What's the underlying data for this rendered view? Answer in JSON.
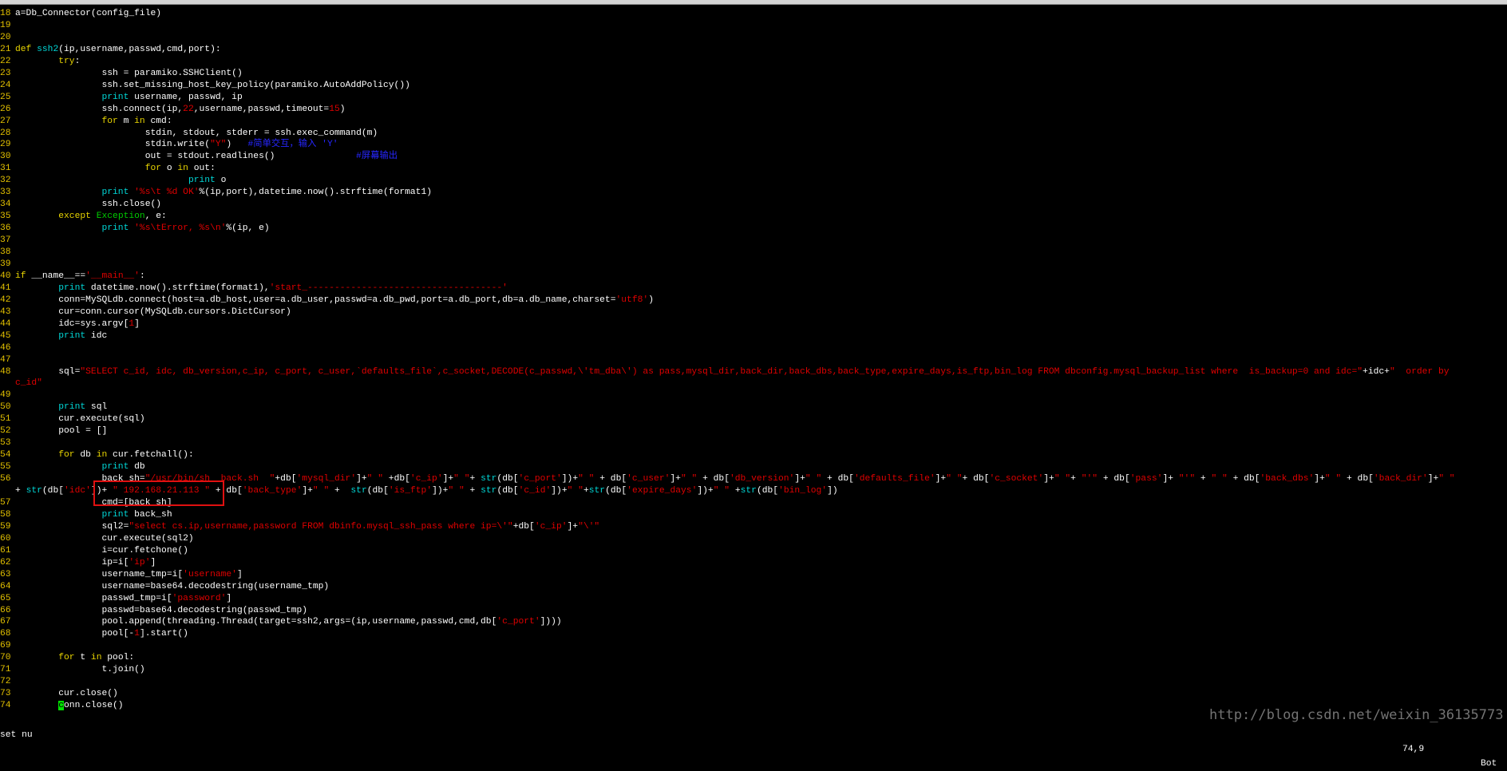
{
  "lines": [
    {
      "n": "18",
      "s": [
        [
          "t",
          "a=Db_Connector(config_file)"
        ]
      ]
    },
    {
      "n": "19",
      "s": []
    },
    {
      "n": "20",
      "s": []
    },
    {
      "n": "21",
      "s": [
        [
          "kw",
          "def"
        ],
        [
          "t",
          " "
        ],
        [
          "fn",
          "ssh2"
        ],
        [
          "t",
          "(ip,username,passwd,cmd,port):"
        ]
      ]
    },
    {
      "n": "22",
      "s": [
        [
          "t",
          "        "
        ],
        [
          "kw",
          "try"
        ],
        [
          "t",
          ":"
        ]
      ]
    },
    {
      "n": "23",
      "s": [
        [
          "t",
          "                ssh = paramiko.SSHClient()"
        ]
      ]
    },
    {
      "n": "24",
      "s": [
        [
          "t",
          "                ssh.set_missing_host_key_policy(paramiko.AutoAddPolicy())"
        ]
      ]
    },
    {
      "n": "25",
      "s": [
        [
          "t",
          "                "
        ],
        [
          "pr",
          "print"
        ],
        [
          "t",
          " username, passwd, ip"
        ]
      ]
    },
    {
      "n": "26",
      "s": [
        [
          "t",
          "                ssh.connect(ip,"
        ],
        [
          "nu",
          "22"
        ],
        [
          "t",
          ",username,passwd,timeout="
        ],
        [
          "nu",
          "15"
        ],
        [
          "t",
          ")"
        ]
      ]
    },
    {
      "n": "27",
      "s": [
        [
          "t",
          "                "
        ],
        [
          "kw",
          "for"
        ],
        [
          "t",
          " m "
        ],
        [
          "kw",
          "in"
        ],
        [
          "t",
          " cmd:"
        ]
      ]
    },
    {
      "n": "28",
      "s": [
        [
          "t",
          "                        stdin, stdout, stderr = ssh.exec_command(m)"
        ]
      ]
    },
    {
      "n": "29",
      "s": [
        [
          "t",
          "                        stdin.write("
        ],
        [
          "st",
          "\"Y\""
        ],
        [
          "t",
          ")   "
        ],
        [
          "cm",
          "#简单交互，输入 'Y'"
        ]
      ]
    },
    {
      "n": "30",
      "s": [
        [
          "t",
          "                        out = stdout.readlines()               "
        ],
        [
          "cm",
          "#屏幕输出"
        ]
      ]
    },
    {
      "n": "31",
      "s": [
        [
          "t",
          "                        "
        ],
        [
          "kw",
          "for"
        ],
        [
          "t",
          " o "
        ],
        [
          "kw",
          "in"
        ],
        [
          "t",
          " out:"
        ]
      ]
    },
    {
      "n": "32",
      "s": [
        [
          "t",
          "                                "
        ],
        [
          "pr",
          "print"
        ],
        [
          "t",
          " o"
        ]
      ]
    },
    {
      "n": "33",
      "s": [
        [
          "t",
          "                "
        ],
        [
          "pr",
          "print"
        ],
        [
          "t",
          " "
        ],
        [
          "st",
          "'%s\\t %d OK'"
        ],
        [
          "t",
          "%(ip,port),datetime.now().strftime(format1)"
        ]
      ]
    },
    {
      "n": "34",
      "s": [
        [
          "t",
          "                ssh.close()"
        ]
      ]
    },
    {
      "n": "35",
      "s": [
        [
          "t",
          "        "
        ],
        [
          "kw",
          "except"
        ],
        [
          "t",
          " "
        ],
        [
          "ex",
          "Exception"
        ],
        [
          "t",
          ", e:"
        ]
      ]
    },
    {
      "n": "36",
      "s": [
        [
          "t",
          "                "
        ],
        [
          "pr",
          "print"
        ],
        [
          "t",
          " "
        ],
        [
          "st",
          "'%s\\tError, %s\\n'"
        ],
        [
          "t",
          "%(ip, e)"
        ]
      ]
    },
    {
      "n": "37",
      "s": []
    },
    {
      "n": "38",
      "s": []
    },
    {
      "n": "39",
      "s": []
    },
    {
      "n": "40",
      "s": [
        [
          "kw",
          "if"
        ],
        [
          "t",
          " __name__=="
        ],
        [
          "st",
          "'__main__'"
        ],
        [
          "t",
          ":"
        ]
      ]
    },
    {
      "n": "41",
      "s": [
        [
          "t",
          "        "
        ],
        [
          "pr",
          "print"
        ],
        [
          "t",
          " datetime.now().strftime(format1),"
        ],
        [
          "st",
          "'start_------------------------------------'"
        ]
      ]
    },
    {
      "n": "42",
      "s": [
        [
          "t",
          "        conn=MySQLdb.connect(host=a.db_host,user=a.db_user,passwd=a.db_pwd,port=a.db_port,db=a.db_name,charset="
        ],
        [
          "st",
          "'utf8'"
        ],
        [
          "t",
          ")"
        ]
      ]
    },
    {
      "n": "43",
      "s": [
        [
          "t",
          "        cur=conn.cursor(MySQLdb.cursors.DictCursor)"
        ]
      ]
    },
    {
      "n": "44",
      "s": [
        [
          "t",
          "        idc=sys.argv["
        ],
        [
          "nu",
          "1"
        ],
        [
          "t",
          "]"
        ]
      ]
    },
    {
      "n": "45",
      "s": [
        [
          "t",
          "        "
        ],
        [
          "pr",
          "print"
        ],
        [
          "t",
          " idc"
        ]
      ]
    },
    {
      "n": "46",
      "s": []
    },
    {
      "n": "47",
      "s": []
    },
    {
      "n": "48",
      "s": [
        [
          "t",
          "        sql="
        ],
        [
          "st",
          "\"SELECT c_id, idc, db_version,c_ip, c_port, c_user,`defaults_file`,c_socket,DECODE(c_passwd,\\'tm_dba\\') as pass,mysql_dir,back_dir,back_dbs,back_type,expire_days,is_ftp,bin_log FROM dbconfig.mysql_backup_list where  is_backup=0 and idc=\""
        ],
        [
          "t",
          "+idc+"
        ],
        [
          "st",
          "\"  order by"
        ]
      ]
    },
    {
      "n": "",
      "s": [
        [
          "st",
          "c_id\""
        ]
      ]
    },
    {
      "n": "49",
      "s": []
    },
    {
      "n": "50",
      "s": [
        [
          "t",
          "        "
        ],
        [
          "pr",
          "print"
        ],
        [
          "t",
          " sql"
        ]
      ]
    },
    {
      "n": "51",
      "s": [
        [
          "t",
          "        cur.execute(sql)"
        ]
      ]
    },
    {
      "n": "52",
      "s": [
        [
          "t",
          "        pool = []"
        ]
      ]
    },
    {
      "n": "53",
      "s": []
    },
    {
      "n": "54",
      "s": [
        [
          "t",
          "        "
        ],
        [
          "kw",
          "for"
        ],
        [
          "t",
          " db "
        ],
        [
          "kw",
          "in"
        ],
        [
          "t",
          " cur.fetchall():"
        ]
      ]
    },
    {
      "n": "55",
      "s": [
        [
          "t",
          "                "
        ],
        [
          "pr",
          "print"
        ],
        [
          "t",
          " db"
        ]
      ]
    },
    {
      "n": "56",
      "s": [
        [
          "t",
          "                back_sh="
        ],
        [
          "st",
          "\"/usr/bin/sh  back.sh  \""
        ],
        [
          "t",
          "+db["
        ],
        [
          "st",
          "'mysql_dir'"
        ],
        [
          "t",
          "]+"
        ],
        [
          "st",
          "\" \""
        ],
        [
          "t",
          " +db["
        ],
        [
          "st",
          "'c_ip'"
        ],
        [
          "t",
          "]+"
        ],
        [
          "st",
          "\" \""
        ],
        [
          "t",
          "+ "
        ],
        [
          "fn",
          "str"
        ],
        [
          "t",
          "(db["
        ],
        [
          "st",
          "'c_port'"
        ],
        [
          "t",
          "])+"
        ],
        [
          "st",
          "\" \""
        ],
        [
          "t",
          " + db["
        ],
        [
          "st",
          "'c_user'"
        ],
        [
          "t",
          "]+"
        ],
        [
          "st",
          "\" \""
        ],
        [
          "t",
          " + db["
        ],
        [
          "st",
          "'db_version'"
        ],
        [
          "t",
          "]+"
        ],
        [
          "st",
          "\" \""
        ],
        [
          "t",
          " + db["
        ],
        [
          "st",
          "'defaults_file'"
        ],
        [
          "t",
          "]+"
        ],
        [
          "st",
          "\" \""
        ],
        [
          "t",
          "+ db["
        ],
        [
          "st",
          "'c_socket'"
        ],
        [
          "t",
          "]+"
        ],
        [
          "st",
          "\" \""
        ],
        [
          "t",
          "+ "
        ],
        [
          "st",
          "\"'\""
        ],
        [
          "t",
          " + db["
        ],
        [
          "st",
          "'pass'"
        ],
        [
          "t",
          "]+ "
        ],
        [
          "st",
          "\"'\""
        ],
        [
          "t",
          " + "
        ],
        [
          "st",
          "\" \""
        ],
        [
          "t",
          " + db["
        ],
        [
          "st",
          "'back_dbs'"
        ],
        [
          "t",
          "]+"
        ],
        [
          "st",
          "\" \""
        ],
        [
          "t",
          " + db["
        ],
        [
          "st",
          "'back_dir'"
        ],
        [
          "t",
          "]+"
        ],
        [
          "st",
          "\" \""
        ]
      ]
    },
    {
      "n": "",
      "s": [
        [
          "t",
          "+ "
        ],
        [
          "fn",
          "str"
        ],
        [
          "t",
          "(db["
        ],
        [
          "st",
          "'idc'"
        ],
        [
          "t",
          "])+ "
        ],
        [
          "st",
          "\" 192.168.21.113 \""
        ],
        [
          "t",
          " + db["
        ],
        [
          "st",
          "'back_type'"
        ],
        [
          "t",
          "]+"
        ],
        [
          "st",
          "\" \""
        ],
        [
          "t",
          " +  "
        ],
        [
          "fn",
          "str"
        ],
        [
          "t",
          "(db["
        ],
        [
          "st",
          "'is_ftp'"
        ],
        [
          "t",
          "])+"
        ],
        [
          "st",
          "\" \""
        ],
        [
          "t",
          " + "
        ],
        [
          "fn",
          "str"
        ],
        [
          "t",
          "(db["
        ],
        [
          "st",
          "'c_id'"
        ],
        [
          "t",
          "])+"
        ],
        [
          "st",
          "\" \""
        ],
        [
          "t",
          "+"
        ],
        [
          "fn",
          "str"
        ],
        [
          "t",
          "(db["
        ],
        [
          "st",
          "'expire_days'"
        ],
        [
          "t",
          "])+"
        ],
        [
          "st",
          "\" \""
        ],
        [
          "t",
          " +"
        ],
        [
          "fn",
          "str"
        ],
        [
          "t",
          "(db["
        ],
        [
          "st",
          "'bin_log'"
        ],
        [
          "t",
          "])"
        ]
      ]
    },
    {
      "n": "57",
      "s": [
        [
          "t",
          "                cmd=[back_sh]"
        ]
      ]
    },
    {
      "n": "58",
      "s": [
        [
          "t",
          "                "
        ],
        [
          "pr",
          "print"
        ],
        [
          "t",
          " back_sh"
        ]
      ]
    },
    {
      "n": "59",
      "s": [
        [
          "t",
          "                sql2="
        ],
        [
          "st",
          "\"select cs.ip,username,password FROM dbinfo.mysql_ssh_pass where ip=\\'\""
        ],
        [
          "t",
          "+db["
        ],
        [
          "st",
          "'c_ip'"
        ],
        [
          "t",
          "]+"
        ],
        [
          "st",
          "\"\\'\""
        ]
      ]
    },
    {
      "n": "60",
      "s": [
        [
          "t",
          "                cur.execute(sql2)"
        ]
      ]
    },
    {
      "n": "61",
      "s": [
        [
          "t",
          "                i=cur.fetchone()"
        ]
      ]
    },
    {
      "n": "62",
      "s": [
        [
          "t",
          "                ip=i["
        ],
        [
          "st",
          "'ip'"
        ],
        [
          "t",
          "]"
        ]
      ]
    },
    {
      "n": "63",
      "s": [
        [
          "t",
          "                username_tmp=i["
        ],
        [
          "st",
          "'username'"
        ],
        [
          "t",
          "]"
        ]
      ]
    },
    {
      "n": "64",
      "s": [
        [
          "t",
          "                username=base64.decodestring(username_tmp)"
        ]
      ]
    },
    {
      "n": "65",
      "s": [
        [
          "t",
          "                passwd_tmp=i["
        ],
        [
          "st",
          "'password'"
        ],
        [
          "t",
          "]"
        ]
      ]
    },
    {
      "n": "66",
      "s": [
        [
          "t",
          "                passwd=base64.decodestring(passwd_tmp)"
        ]
      ]
    },
    {
      "n": "67",
      "s": [
        [
          "t",
          "                pool.append(threading.Thread(target=ssh2,args=(ip,username,passwd,cmd,db["
        ],
        [
          "st",
          "'c_port'"
        ],
        [
          "t",
          "])))"
        ]
      ]
    },
    {
      "n": "68",
      "s": [
        [
          "t",
          "                pool[-"
        ],
        [
          "nu",
          "1"
        ],
        [
          "t",
          "].start()"
        ]
      ]
    },
    {
      "n": "69",
      "s": []
    },
    {
      "n": "70",
      "s": [
        [
          "t",
          "        "
        ],
        [
          "kw",
          "for"
        ],
        [
          "t",
          " t "
        ],
        [
          "kw",
          "in"
        ],
        [
          "t",
          " pool:"
        ]
      ]
    },
    {
      "n": "71",
      "s": [
        [
          "t",
          "                t.join()"
        ]
      ]
    },
    {
      "n": "72",
      "s": []
    },
    {
      "n": "73",
      "s": [
        [
          "t",
          "        cur.close()"
        ]
      ]
    },
    {
      "n": "74",
      "s": [
        [
          "t",
          "        "
        ],
        [
          "cursor",
          "c"
        ],
        [
          "t",
          "onn.close()"
        ]
      ]
    }
  ],
  "status": {
    "command": "set nu",
    "cursor_position": "74,9",
    "scroll_position": "Bot"
  },
  "watermark": "http://blog.csdn.net/weixin_36135773"
}
